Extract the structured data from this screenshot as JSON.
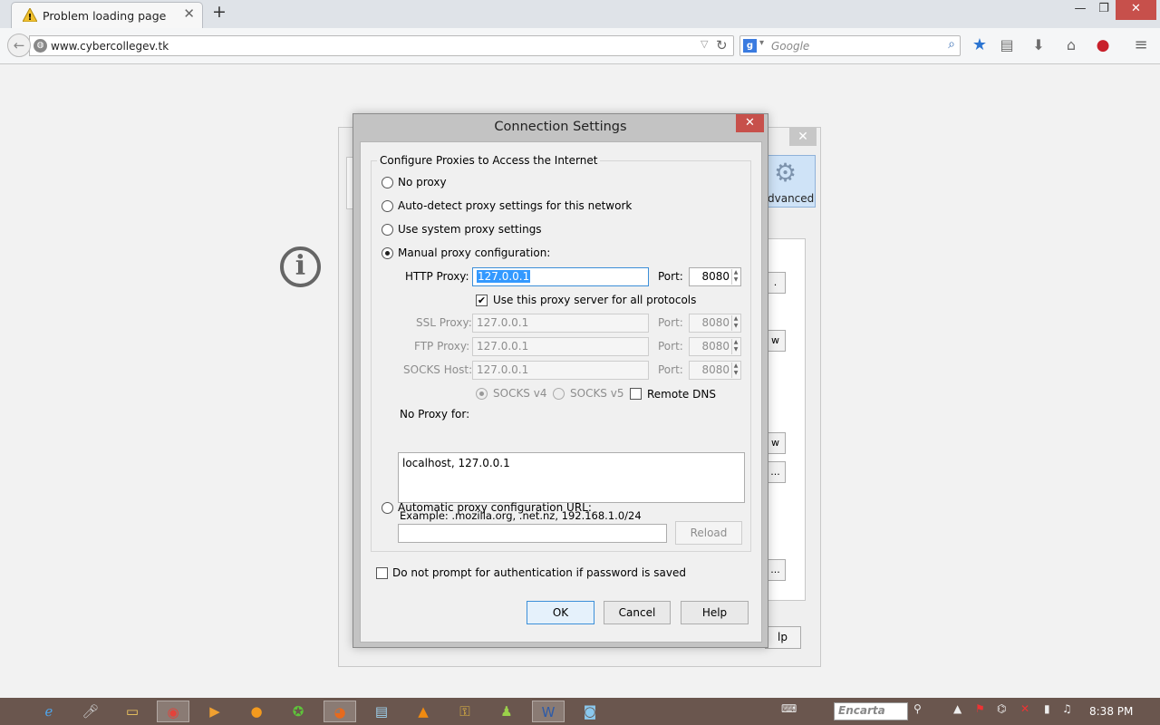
{
  "browser": {
    "tab_title": "Problem loading page",
    "tab_close": "✕",
    "new_tab": "+",
    "window_controls": {
      "minimize": "—",
      "maximize": "❐",
      "close": "✕"
    },
    "url": "www.cybercollegev.tk",
    "search_engine_badge": "g",
    "search_placeholder": "Google",
    "toolbar_icons": [
      "bookmark-star-icon",
      "reading-list-icon",
      "download-icon",
      "home-icon",
      "pinterest-icon",
      "menu-icon"
    ]
  },
  "page": {
    "info_icon": "i"
  },
  "options_window": {
    "close": "✕",
    "advanced_tab_label": "dvanced",
    "button_fragments": [
      ".",
      "w",
      "w",
      "...",
      "..."
    ],
    "help_fragment": "lp"
  },
  "dialog": {
    "title": "Connection Settings",
    "close": "✕",
    "group_title": "Configure Proxies to Access the Internet",
    "options": {
      "no_proxy": "No proxy",
      "auto_detect": "Auto-detect proxy settings for this network",
      "system": "Use system proxy settings",
      "manual": "Manual proxy configuration:",
      "auto_url": "Automatic proxy configuration URL:"
    },
    "selected_option": "manual",
    "http_proxy_label": "HTTP Proxy:",
    "http_proxy_value": "127.0.0.1",
    "port_label": "Port:",
    "http_port": "8080",
    "use_for_all_label": "Use this proxy server for all protocols",
    "use_for_all_checked": true,
    "ssl_label": "SSL Proxy:",
    "ssl_value": "127.0.0.1",
    "ssl_port": "8080",
    "ftp_label": "FTP Proxy:",
    "ftp_value": "127.0.0.1",
    "ftp_port": "8080",
    "socks_label": "SOCKS Host:",
    "socks_value": "127.0.0.1",
    "socks_port": "8080",
    "socks_v4": "SOCKS v4",
    "socks_v5": "SOCKS v5",
    "remote_dns": "Remote DNS",
    "no_proxy_label": "No Proxy for:",
    "no_proxy_value": "localhost, 127.0.0.1",
    "example": "Example: .mozilla.org, .net.nz, 192.168.1.0/24",
    "auto_url_value": "",
    "reload": "Reload",
    "no_prompt_auth": "Do not prompt for authentication if password is saved",
    "ok": "OK",
    "cancel": "Cancel",
    "help": "Help"
  },
  "taskbar": {
    "apps": [
      "internet-explorer-icon",
      "mic-icon",
      "file-explorer-icon",
      "chrome-icon",
      "media-player-icon",
      "firefox-orange-icon",
      "green-app-icon",
      "firefox-icon",
      "notepad-icon",
      "vlc-icon",
      "key-icon",
      "android-icon",
      "word-icon",
      "camera-icon"
    ],
    "active_app": "firefox-icon",
    "search_box": "Encarta",
    "time": "8:38 PM"
  }
}
